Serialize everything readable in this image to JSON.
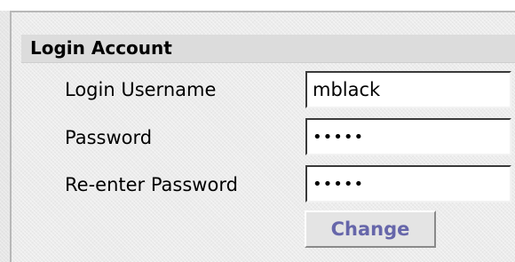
{
  "section": {
    "title": "Login Account"
  },
  "fields": {
    "username": {
      "label": "Login Username",
      "value": "mblack"
    },
    "password": {
      "label": "Password",
      "value": "•••••"
    },
    "confirm_password": {
      "label": "Re-enter Password",
      "value": "•••••"
    }
  },
  "actions": {
    "change_label": "Change"
  },
  "colors": {
    "button_text": "#6666aa",
    "panel_background": "#ececec",
    "header_background": "#dcdcdc"
  }
}
